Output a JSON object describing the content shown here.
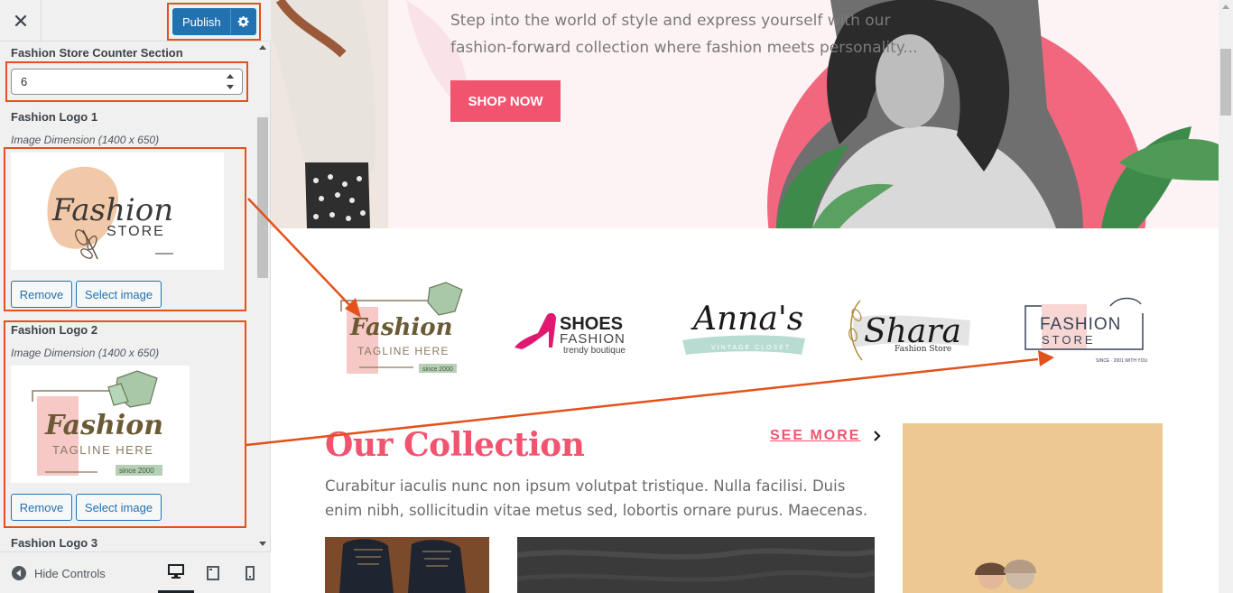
{
  "sidebar": {
    "close_label": "Close",
    "publish_label": "Publish",
    "counter_section": {
      "title": "Fashion Store Counter Section",
      "value": "6"
    },
    "logos": [
      {
        "title": "Fashion Logo 1",
        "description": "Image Dimension (1400 x 650)",
        "thumb": {
          "script": "Fashion",
          "word": "STORE"
        },
        "remove_label": "Remove",
        "select_label": "Select image"
      },
      {
        "title": "Fashion Logo 2",
        "description": "Image Dimension (1400 x 650)",
        "thumb": {
          "script": "Fashion",
          "tagline": "TAGLINE HERE",
          "since": "since 2000"
        },
        "remove_label": "Remove",
        "select_label": "Select image"
      },
      {
        "title": "Fashion Logo 3"
      }
    ],
    "footer": {
      "hide_controls_label": "Hide Controls",
      "devices": [
        "desktop-icon",
        "tablet-icon",
        "mobile-icon"
      ]
    }
  },
  "preview": {
    "hero": {
      "text": "Step into the world of style and express yourself with our fashion-forward collection where fashion meets personality...",
      "cta_label": "SHOP NOW"
    },
    "brands": [
      {
        "name": "Fashion",
        "tagline": "TAGLINE HERE",
        "since": "since 2000"
      },
      {
        "name": "SHOES",
        "sub": "FASHION",
        "tagline": "trendy boutique"
      },
      {
        "name": "Anna's",
        "tagline": "VINTAGE CLOSET"
      },
      {
        "name": "Shara",
        "tagline": "Fashion Store"
      },
      {
        "name": "FASHION",
        "sub": "STORE",
        "tagline": "SINCE · 2001 WITH YOU"
      }
    ],
    "collection": {
      "title": "Our Collection",
      "see_more_label": "SEE MORE",
      "text": "Curabitur iaculis nunc non ipsum volutpat tristique. Nulla facilisi. Duis enim nibh, sollicitudin vitae metus sed, lobortis ornare purus. Maecenas."
    }
  },
  "colors": {
    "accent": "#f1546f",
    "publish": "#2271b1",
    "highlight": "#e2521a",
    "sidebar_bg": "#f0f0f1"
  }
}
